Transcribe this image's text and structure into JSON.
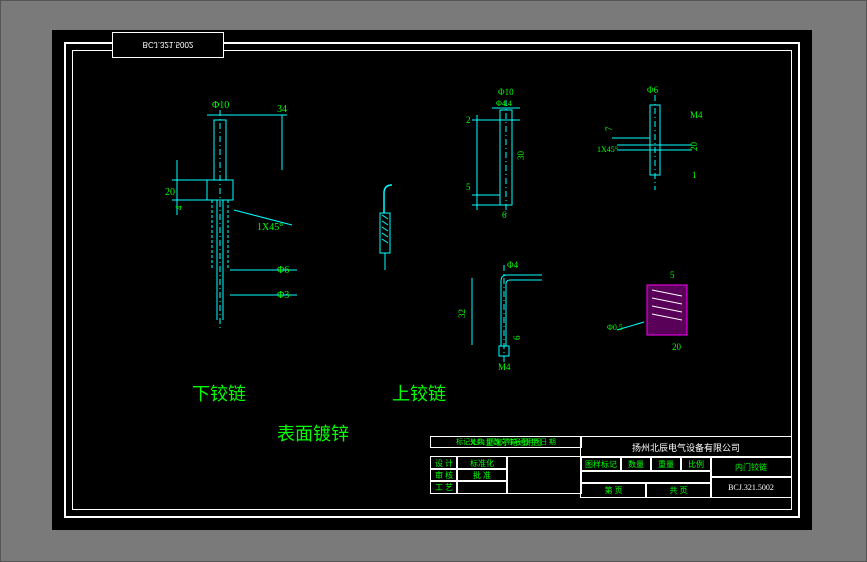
{
  "drawing_number_tab": "BCJ.321.5002",
  "labels": {
    "lower_hinge": "下铰链",
    "upper_hinge": "上铰链",
    "surface_galvanized": "表面镀锌"
  },
  "dims": {
    "left_view": {
      "dia_top": "Φ10",
      "offset": "34",
      "vert_20": "20",
      "chamfer": "1X45°",
      "dia_6": "Φ6",
      "dia_3": "Φ3"
    },
    "mid_top": {
      "dia_10": "Φ10",
      "w_44": "Φ4.4",
      "h_2": "2",
      "h_30": "30",
      "h_5": "5",
      "h_6": "6"
    },
    "mid_bot": {
      "dia_4": "Φ4",
      "h_32": "32",
      "end_6": "6",
      "thread": "M4"
    },
    "right_top": {
      "dia_6": "Φ6",
      "thread": "M4",
      "h_7": "7",
      "h_20": "20",
      "chamfer": "1X45°",
      "w_1": "1"
    },
    "right_bot": {
      "w_5": "5",
      "dia": "Φ0.5",
      "h_20": "20"
    }
  },
  "title_block": {
    "product_line": "XJ-1型端子箱通用图",
    "company": "扬州北辰电气设备有限公司",
    "part_name": "内门铰链",
    "drawing_no": "BCJ.321.5002",
    "headers": {
      "mark": "标记处数",
      "doc": "更改文件号",
      "sig": "签 字",
      "date": "日 期",
      "zone": "图样标记",
      "qty": "数量",
      "wt": "重量",
      "scale": "比例"
    },
    "rows": {
      "design": "设 计",
      "std": "标准化",
      "check": "审 核",
      "proc": "工 艺",
      "approve": "批 准",
      "page": "第  页",
      "total": "共  页"
    }
  }
}
